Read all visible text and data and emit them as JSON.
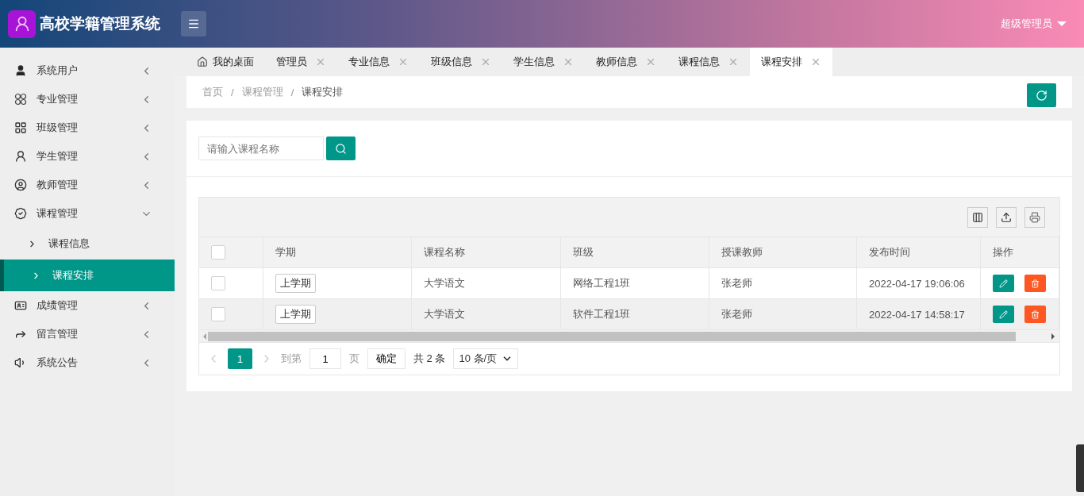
{
  "header": {
    "title": "高校学籍管理系统",
    "user": "超级管理员"
  },
  "sidebar": {
    "items": [
      {
        "label": "系统用户",
        "expanded": false
      },
      {
        "label": "专业管理",
        "expanded": false
      },
      {
        "label": "班级管理",
        "expanded": false
      },
      {
        "label": "学生管理",
        "expanded": false
      },
      {
        "label": "教师管理",
        "expanded": false
      },
      {
        "label": "课程管理",
        "expanded": true,
        "children": [
          {
            "label": "课程信息",
            "selected": false
          },
          {
            "label": "课程安排",
            "selected": true
          }
        ]
      },
      {
        "label": "成绩管理",
        "expanded": false
      },
      {
        "label": "留言管理",
        "expanded": false
      },
      {
        "label": "系统公告",
        "expanded": false
      }
    ]
  },
  "tabs": [
    {
      "label": "我的桌面",
      "kind": "home",
      "selected": false
    },
    {
      "label": "管理员",
      "kind": "closable",
      "selected": false
    },
    {
      "label": "专业信息",
      "kind": "closable",
      "selected": false
    },
    {
      "label": "班级信息",
      "kind": "closable",
      "selected": false
    },
    {
      "label": "学生信息",
      "kind": "closable",
      "selected": false
    },
    {
      "label": "教师信息",
      "kind": "closable",
      "selected": false
    },
    {
      "label": "课程信息",
      "kind": "closable",
      "selected": false
    },
    {
      "label": "课程安排",
      "kind": "closable",
      "selected": true
    }
  ],
  "breadcrumb": [
    {
      "kind": "link",
      "text": "首页"
    },
    {
      "kind": "separator",
      "text": "/"
    },
    {
      "kind": "link",
      "text": "课程管理"
    },
    {
      "kind": "separator",
      "text": "/"
    },
    {
      "kind": "current",
      "text": "课程安排"
    }
  ],
  "search": {
    "placeholder": "请输入课程名称"
  },
  "table": {
    "all_checked": false,
    "columns": [
      "学期",
      "课程名称",
      "班级",
      "授课教师",
      "发布时间",
      "操作"
    ],
    "rows": [
      {
        "checked": false,
        "highlighted": false,
        "cells": [
          "上学期",
          "大学语文",
          "网络工程1班",
          "张老师",
          "2022-04-17 19:06:06"
        ]
      },
      {
        "checked": false,
        "highlighted": true,
        "cells": [
          "上学期",
          "大学语文",
          "软件工程1班",
          "张老师",
          "2022-04-17 14:58:17"
        ]
      }
    ]
  },
  "pagination": {
    "current": "1",
    "goto_label": "到第",
    "goto_value": "1",
    "page_label": "页",
    "confirm": "确定",
    "total": "共 2 条",
    "page_size": "10 条/页"
  }
}
